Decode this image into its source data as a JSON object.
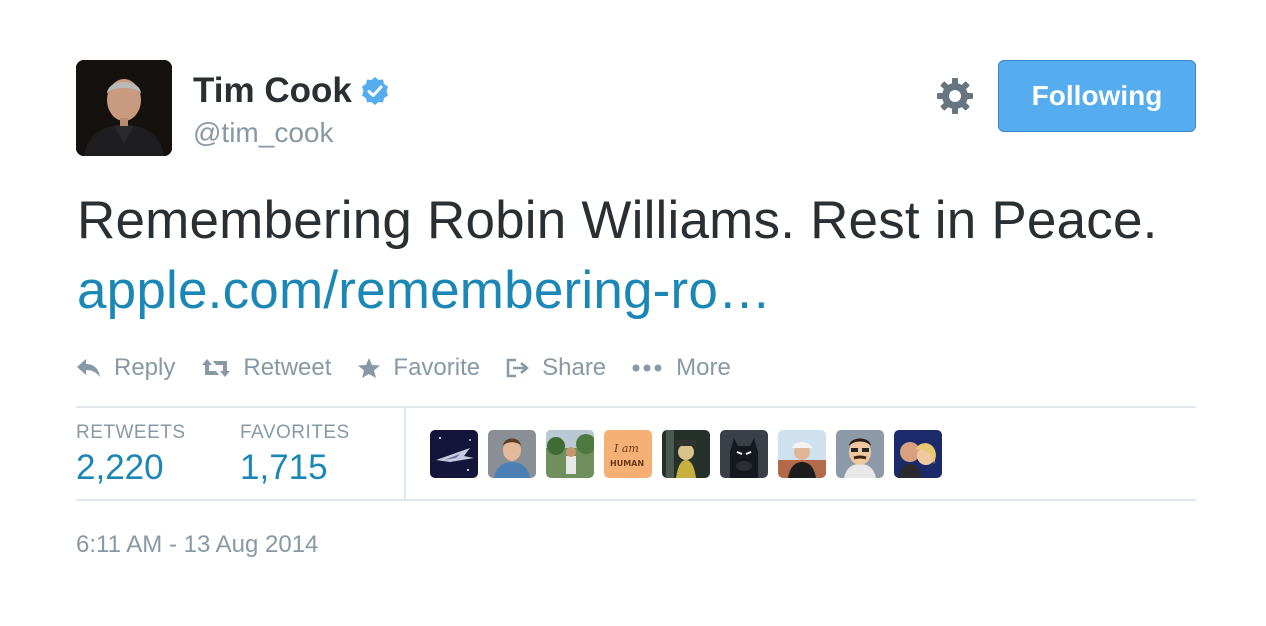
{
  "user": {
    "name": "Tim Cook",
    "handle": "@tim_cook",
    "verified": true
  },
  "follow_button": {
    "label": "Following",
    "color": "#55acee"
  },
  "tweet": {
    "text": "Remembering Robin Williams.  Rest in Peace.  ",
    "link": "apple.com/remembering-ro…",
    "link_color": "#1b87b6"
  },
  "actions": [
    {
      "label": "Reply",
      "icon": "reply-icon"
    },
    {
      "label": "Retweet",
      "icon": "retweet-icon"
    },
    {
      "label": "Favorite",
      "icon": "star-icon"
    },
    {
      "label": "Share",
      "icon": "share-icon"
    },
    {
      "label": "More",
      "icon": "more-icon"
    }
  ],
  "stats": {
    "retweets_label": "RETWEETS",
    "retweets_value": "2,220",
    "favorites_label": "FAVORITES",
    "favorites_value": "1,715"
  },
  "favoriters": [
    {
      "icon": "spaceship-avatar"
    },
    {
      "icon": "man-avatar"
    },
    {
      "icon": "outdoor-person-avatar"
    },
    {
      "icon": "i-am-human-avatar",
      "text": "I am HUMAN"
    },
    {
      "icon": "figure-avatar"
    },
    {
      "icon": "batman-avatar"
    },
    {
      "icon": "cap-person-avatar"
    },
    {
      "icon": "cartoon-man-avatar"
    },
    {
      "icon": "couple-avatar"
    }
  ],
  "timestamp": "6:11 AM - 13 Aug 2014"
}
